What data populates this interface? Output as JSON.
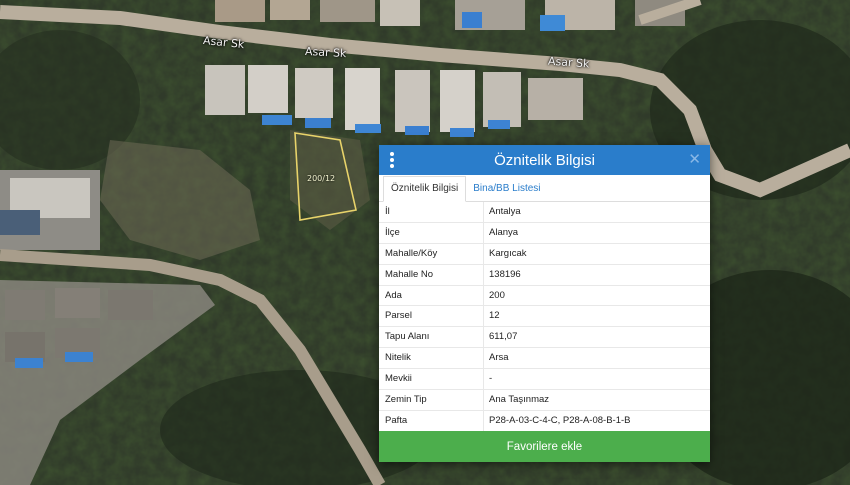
{
  "map": {
    "road_labels": [
      "Asar Sk",
      "Asar Sk",
      "Asar Sk"
    ],
    "parcel_label": "200/12",
    "parcel_outline_color": "#e8d36a"
  },
  "panel": {
    "title": "Öznitelik Bilgisi",
    "header_color": "#2a7dcb",
    "tabs": [
      {
        "label": "Öznitelik Bilgisi",
        "active": true
      },
      {
        "label": "Bina/BB Listesi",
        "active": false
      }
    ],
    "rows": [
      {
        "key": "İl",
        "value": "Antalya"
      },
      {
        "key": "İlçe",
        "value": "Alanya"
      },
      {
        "key": "Mahalle/Köy",
        "value": "Kargıcak"
      },
      {
        "key": "Mahalle No",
        "value": "138196"
      },
      {
        "key": "Ada",
        "value": "200"
      },
      {
        "key": "Parsel",
        "value": "12"
      },
      {
        "key": "Tapu Alanı",
        "value": "611,07"
      },
      {
        "key": "Nitelik",
        "value": "Arsa"
      },
      {
        "key": "Mevkii",
        "value": "-"
      },
      {
        "key": "Zemin Tip",
        "value": "Ana Taşınmaz"
      },
      {
        "key": "Pafta",
        "value": "P28-A-03-C-4-C, P28-A-08-B-1-B"
      }
    ],
    "favorite_button_label": "Favorilere ekle",
    "favorite_button_color": "#4cae4c"
  }
}
